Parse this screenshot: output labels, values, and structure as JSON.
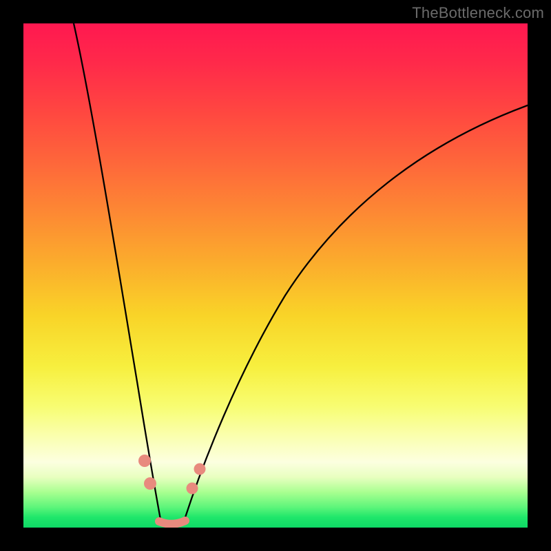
{
  "watermark": "TheBottleneck.com",
  "colors": {
    "frame_bg": "#000000",
    "gradient_top": "#ff1850",
    "gradient_mid": "#f9d428",
    "gradient_bottom": "#0fd966",
    "curve_stroke": "#000000",
    "marker_fill": "#e88a7e"
  },
  "chart_data": {
    "type": "line",
    "title": "",
    "xlabel": "",
    "ylabel": "",
    "xlim": [
      0,
      100
    ],
    "ylim": [
      0,
      100
    ],
    "series": [
      {
        "name": "left-branch",
        "x": [
          10.0,
          12.0,
          14.0,
          16.0,
          18.0,
          20.0,
          22.0,
          23.5,
          25.0,
          26.3,
          27.2
        ],
        "y": [
          100.0,
          88.0,
          76.0,
          64.0,
          52.0,
          41.0,
          30.0,
          20.0,
          12.0,
          5.0,
          1.0
        ]
      },
      {
        "name": "valley-floor",
        "x": [
          27.2,
          28.0,
          29.0,
          30.0,
          31.0,
          32.0
        ],
        "y": [
          1.0,
          0.5,
          0.3,
          0.3,
          0.5,
          1.0
        ]
      },
      {
        "name": "right-branch",
        "x": [
          32.0,
          34.0,
          37.0,
          41.0,
          46.0,
          52.0,
          59.0,
          67.0,
          76.0,
          86.0,
          97.0,
          100.0
        ],
        "y": [
          1.0,
          6.0,
          14.0,
          24.0,
          34.5,
          45.0,
          54.5,
          63.0,
          70.5,
          77.0,
          82.5,
          83.8
        ]
      }
    ],
    "markers": [
      {
        "name": "left-upper",
        "x": 24.0,
        "y": 13.0,
        "r": 1.3
      },
      {
        "name": "left-lower",
        "x": 25.2,
        "y": 8.5,
        "r": 1.3
      },
      {
        "name": "right-lower",
        "x": 33.5,
        "y": 7.5,
        "r": 1.2
      },
      {
        "name": "right-upper",
        "x": 35.0,
        "y": 11.5,
        "r": 1.2
      },
      {
        "name": "floor",
        "x_from": 27.0,
        "x_to": 32.0,
        "y": 1.0
      }
    ]
  }
}
